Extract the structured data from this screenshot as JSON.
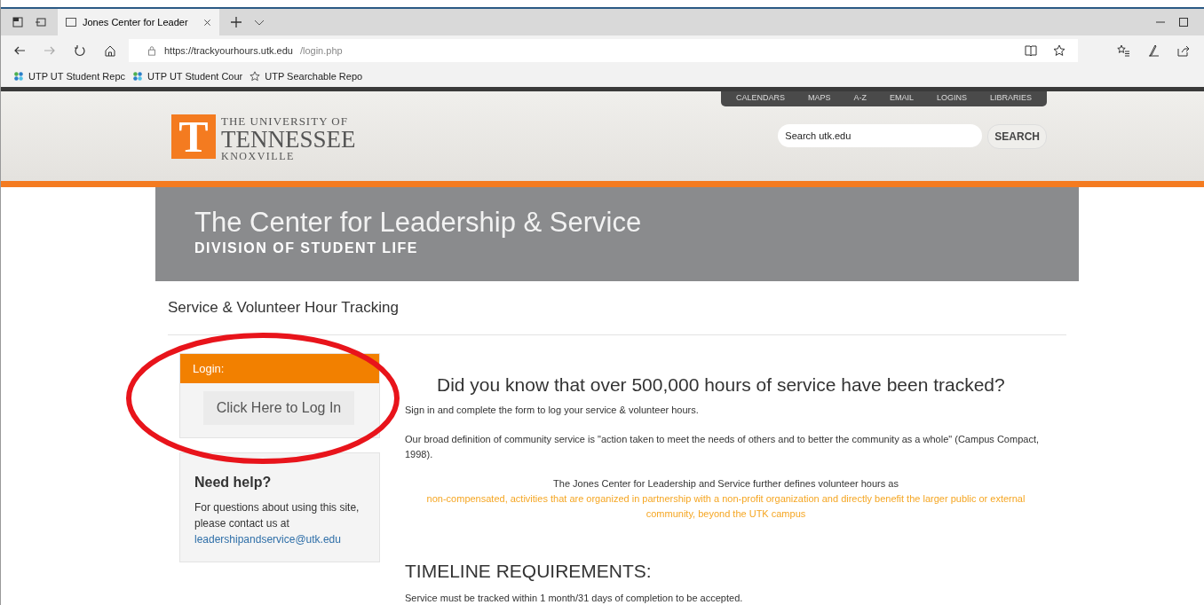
{
  "browser": {
    "tabs": [
      {
        "title": "Jones Center for Leader",
        "selected": true
      }
    ],
    "url_host": "https://trackyourhours.utk.edu",
    "url_path": "/login.php",
    "bookmarks": [
      {
        "label": "UTP UT Student Repc",
        "kind": "apps"
      },
      {
        "label": "UTP UT Student Cour",
        "kind": "apps"
      },
      {
        "label": "UTP Searchable Repo",
        "kind": "star"
      }
    ]
  },
  "header": {
    "logo_mark": "T",
    "logo_line1": "THE UNIVERSITY OF",
    "logo_line2": "TENNESSEE",
    "logo_line3": "KNOXVILLE",
    "top_links": [
      "CALENDARS",
      "MAPS",
      "A-Z",
      "EMAIL",
      "LOGINS",
      "LIBRARIES"
    ],
    "search": {
      "placeholder": "Search utk.edu",
      "button": "SEARCH"
    }
  },
  "banner": {
    "title": "The Center for Leadership & Service",
    "subtitle": "DIVISION OF STUDENT LIFE"
  },
  "page_title": "Service & Volunteer Hour Tracking",
  "login_box": {
    "heading": "Login:",
    "button": "Click Here to Log In"
  },
  "help_box": {
    "heading": "Need help?",
    "text": "For questions about using this site, please contact us at",
    "email": "leadershipandservice@utk.edu"
  },
  "main": {
    "headline": "Did you know that over 500,000 hours of service have been tracked?",
    "intro": "Sign in and complete the form to log your service & volunteer hours.",
    "definition": "Our broad definition of community service is \"action taken to meet the needs of others and to better the community as a whole\" (Campus Compact, 1998).",
    "further": "The Jones Center for Leadership and Service further defines volunteer hours as",
    "further_highlight": "non-compensated, activities that are organized in partnership with a non-profit organization and directly benefit the larger public or external community, beyond the UTK campus",
    "timeline_heading": "TIMELINE REQUIREMENTS:",
    "timeline_text": "Service must be tracked within 1 month/31 days of completion to be accepted."
  }
}
